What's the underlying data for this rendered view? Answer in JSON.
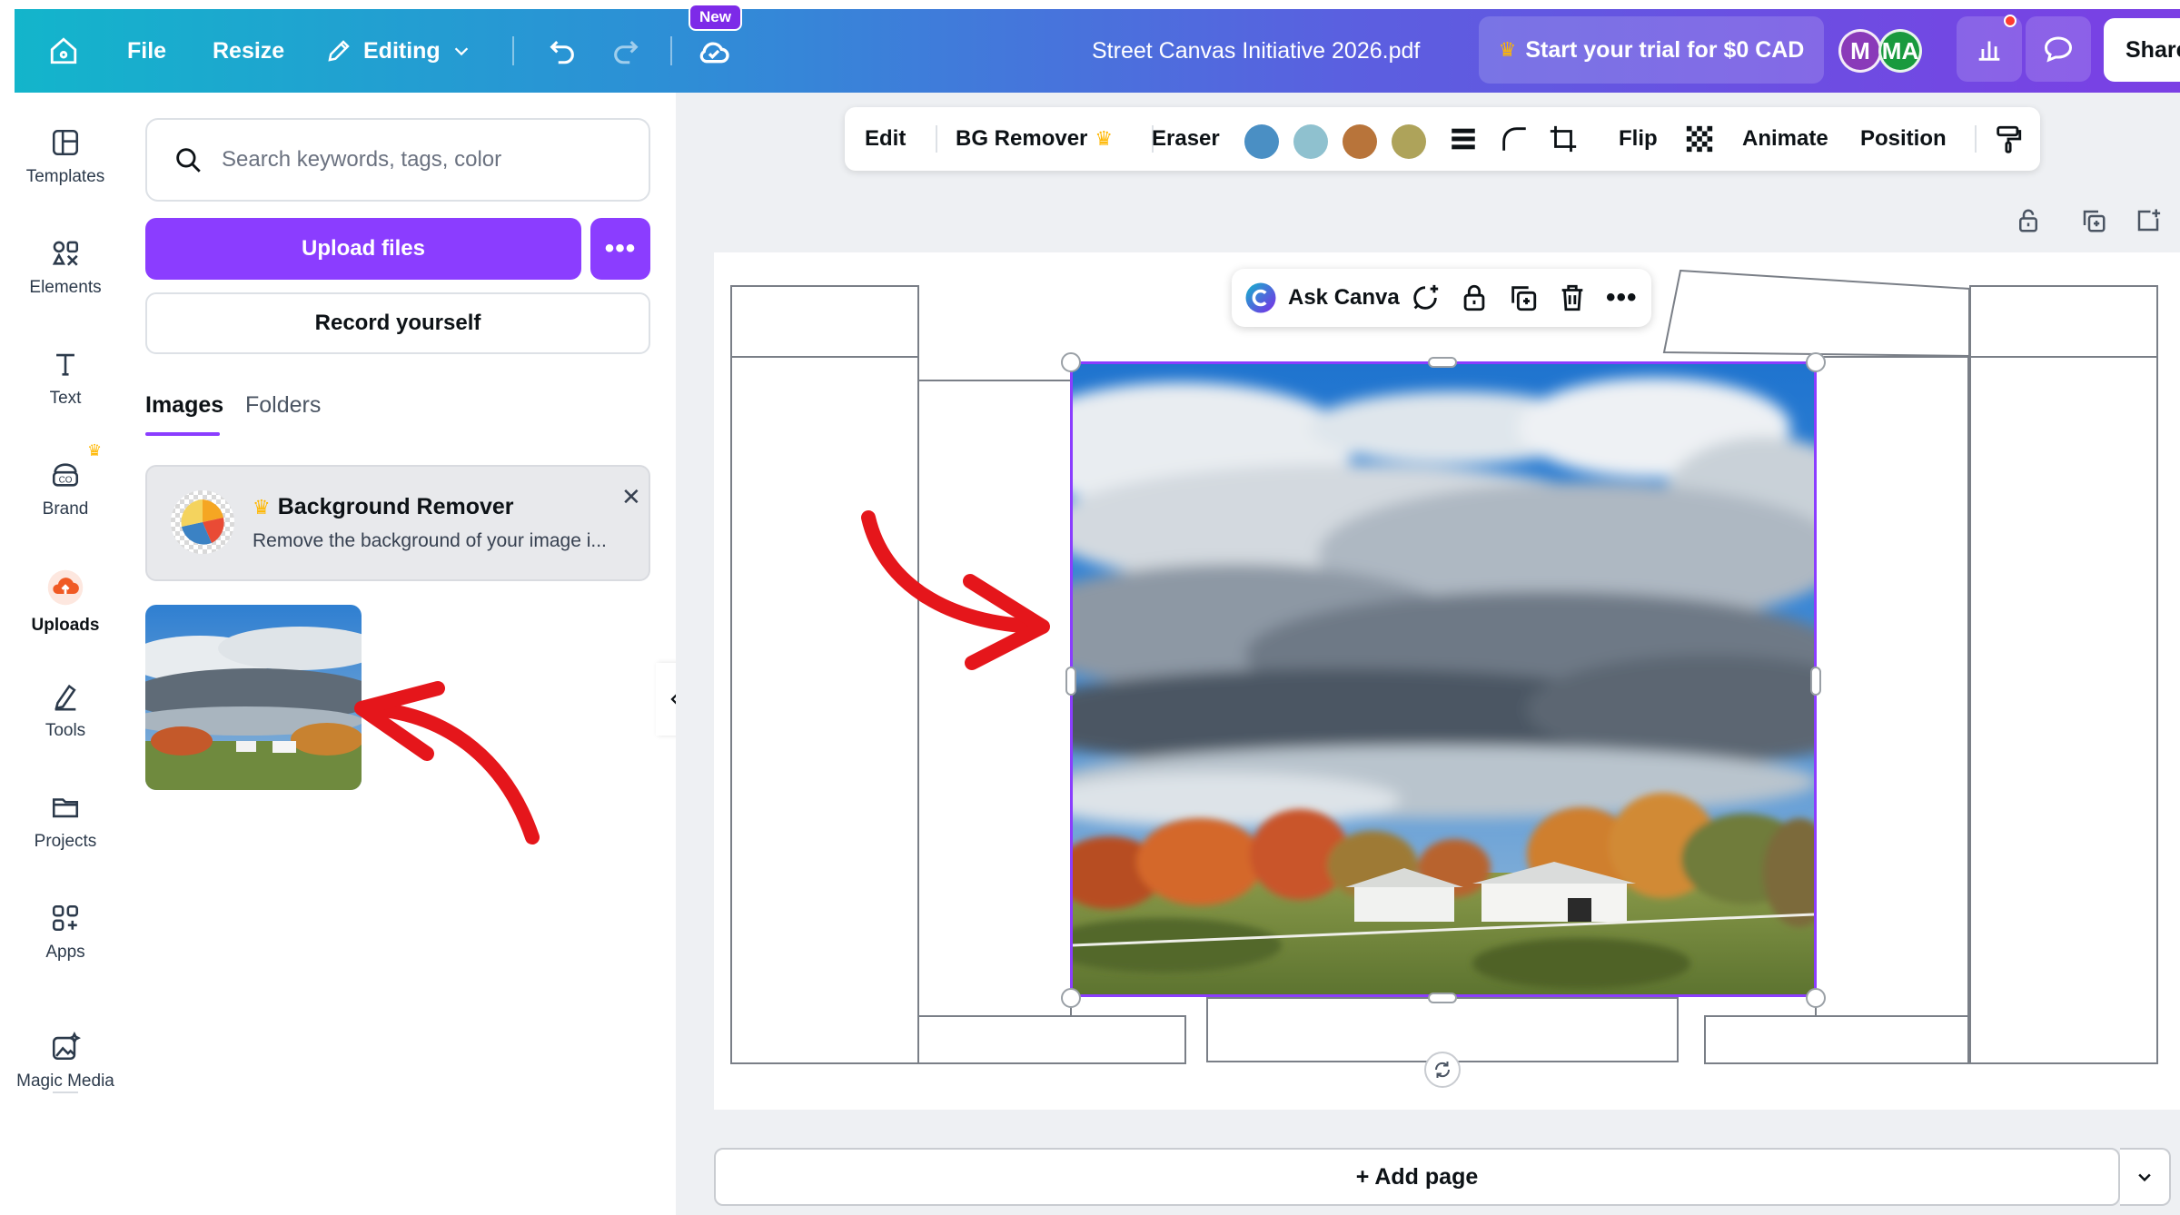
{
  "topbar": {
    "file_label": "File",
    "resize_label": "Resize",
    "editing_label": "Editing",
    "new_badge": "New",
    "doc_title": "Street Canvas Initiative 2026.pdf",
    "trial_label": "Start your trial for $0 CAD",
    "avatars": [
      "M",
      "MA"
    ],
    "share_label": "Share"
  },
  "rail": {
    "items": [
      {
        "label": "Templates",
        "icon": "templates-icon"
      },
      {
        "label": "Elements",
        "icon": "elements-icon"
      },
      {
        "label": "Text",
        "icon": "text-icon"
      },
      {
        "label": "Brand",
        "icon": "brand-icon"
      },
      {
        "label": "Uploads",
        "icon": "uploads-icon"
      },
      {
        "label": "Tools",
        "icon": "tools-icon"
      },
      {
        "label": "Projects",
        "icon": "projects-icon"
      },
      {
        "label": "Apps",
        "icon": "apps-icon"
      },
      {
        "label": "Magic Media",
        "icon": "magic-media-icon"
      }
    ],
    "active": "Uploads"
  },
  "panel": {
    "search_placeholder": "Search keywords, tags, color",
    "upload_label": "Upload files",
    "upload_more": "•••",
    "record_label": "Record yourself",
    "tabs": [
      "Images",
      "Folders"
    ],
    "promo": {
      "title": "Background Remover",
      "description": "Remove the background of your image i..."
    }
  },
  "toolbar": {
    "edit": "Edit",
    "bg_remover": "BG Remover",
    "eraser": "Eraser",
    "flip": "Flip",
    "animate": "Animate",
    "position": "Position",
    "swatches": [
      "#4a8fc4",
      "#8fc1cf",
      "#b8743a",
      "#aea35a"
    ]
  },
  "canvas": {
    "ask_label": "Ask Canva",
    "add_page_label": "+ Add page"
  },
  "colors": {
    "accent": "#8b3dff",
    "annotation": "#e5161b"
  }
}
